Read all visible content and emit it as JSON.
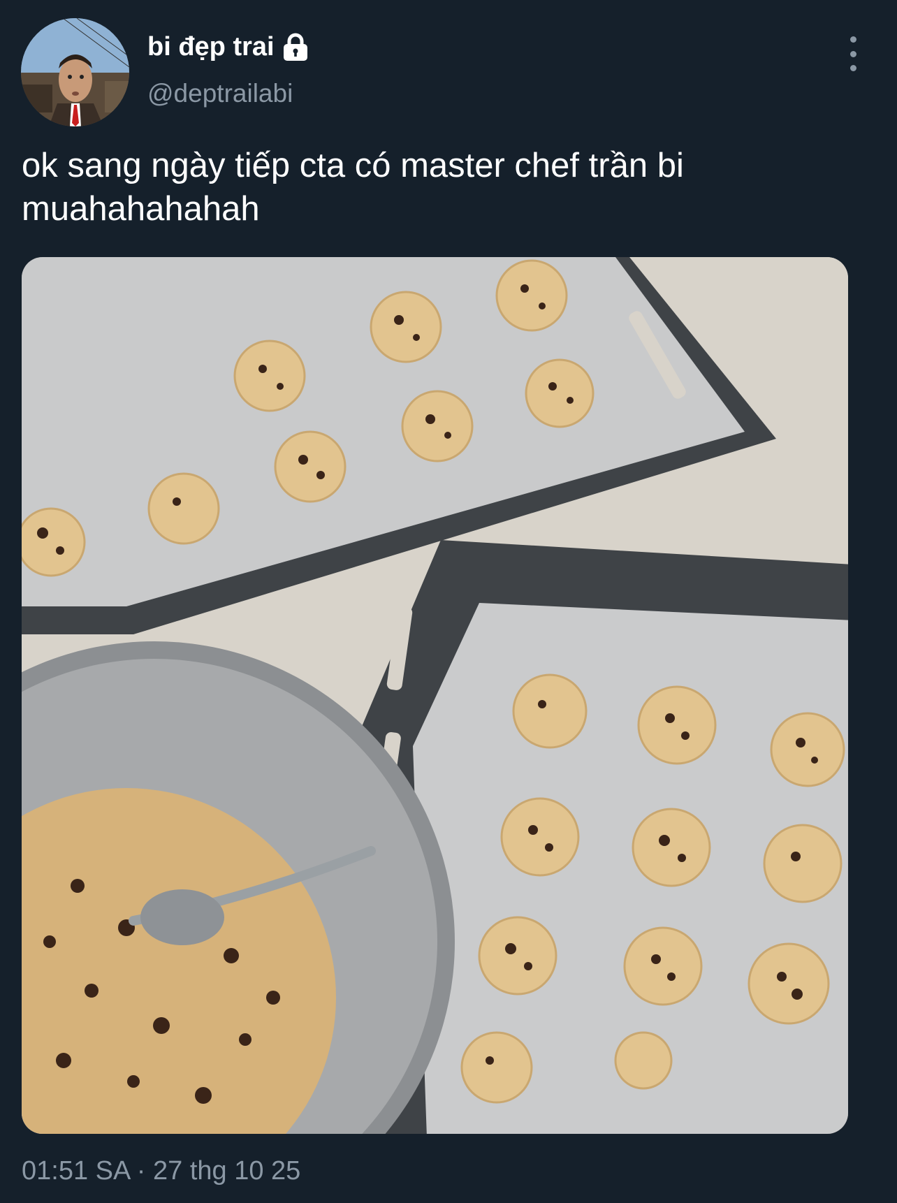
{
  "author": {
    "display_name": "bi đẹp trai",
    "handle": "@deptrailabi",
    "protected_icon": "lock-icon"
  },
  "tweet": {
    "text": "ok sang ngày tiếp cta có master chef trần bi muahahahahah",
    "timestamp": "01:51 SA · 27 thg 10 25"
  },
  "icons": {
    "more": "more-vertical-icon"
  },
  "colors": {
    "background": "#15202b",
    "primary_text": "#ffffff",
    "secondary_text": "#8b98a5"
  }
}
